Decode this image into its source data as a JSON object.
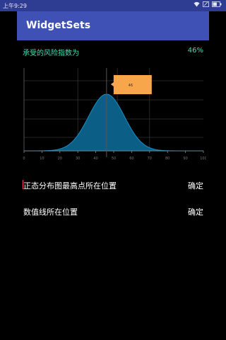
{
  "status": {
    "time": "上午9:29",
    "battery_level": 0.6
  },
  "appbar": {
    "title": "WidgetSets"
  },
  "risk": {
    "label": "承受的风险指数为",
    "value": "46%"
  },
  "chart_data": {
    "type": "area",
    "x_tick_labels": [
      "0",
      "10",
      "20",
      "30",
      "40",
      "50",
      "60",
      "70",
      "80",
      "90",
      "100"
    ],
    "xlim": [
      0,
      100
    ],
    "mean": 46,
    "std_dev": 10,
    "marker_x": 46,
    "tooltip_text": "46",
    "grid": true,
    "fill_color": "#0b5e86",
    "line_color": "#1b8fc4",
    "tooltip_color": "#f7a64b"
  },
  "rows": [
    {
      "text": "正态分布图最高点所在位置",
      "button": "确定"
    },
    {
      "text": "数值线所在位置",
      "button": "确定"
    }
  ]
}
